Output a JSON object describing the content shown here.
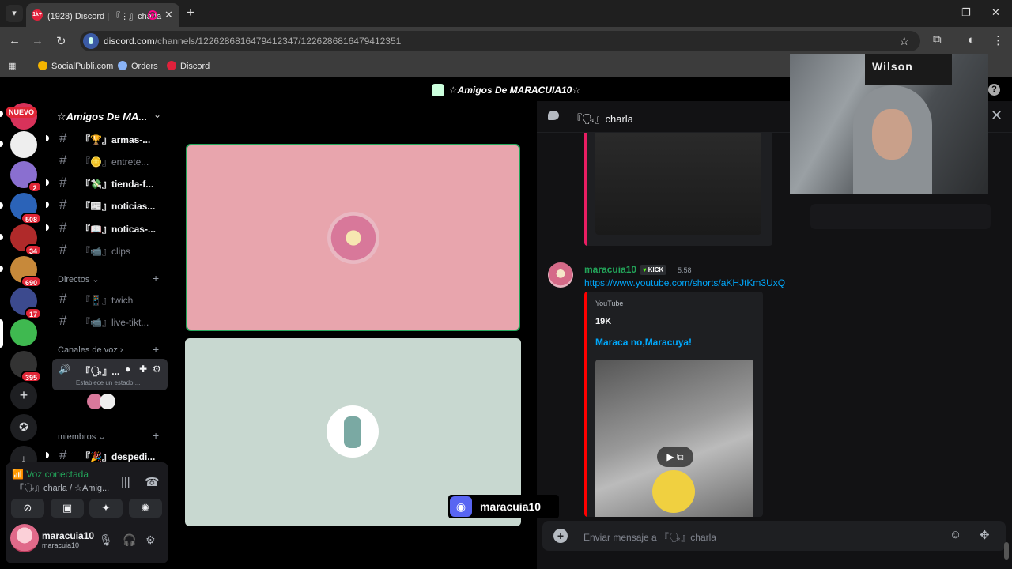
{
  "browser": {
    "tab_title": "(1928) Discord | 『⋮』charla",
    "tab_favicon_text": "1k+",
    "url_host": "discord.com",
    "url_path": "/channels/1226286816479412347/1226286816479412351",
    "bookmarks": [
      {
        "label": "SocialPubli.com",
        "color": "#f4b400"
      },
      {
        "label": "Orders",
        "color": "#8ab4f8"
      },
      {
        "label": "Discord",
        "color": "#e0213b"
      }
    ]
  },
  "discord": {
    "top_title": "☆Amigos De MARACUIA10☆",
    "servers": {
      "nuevo": "NUEVO",
      "badges": [
        "2",
        "508",
        "34",
        "690",
        "17",
        "395"
      ]
    },
    "guild_name": "☆Amigos De MA...",
    "channels": [
      {
        "label": "『🏆』armas-...",
        "unread": true
      },
      {
        "label": "『🪙』entrete...",
        "unread": false
      },
      {
        "label": "『💸』tienda-f...",
        "unread": true
      },
      {
        "label": "『📰』noticias...",
        "unread": true
      },
      {
        "label": "『📖』noticas-...",
        "unread": true
      },
      {
        "label": "『📹』clips",
        "unread": false
      }
    ],
    "category_directos": "Directos",
    "directos_channels": [
      {
        "label": "『📱』twich"
      },
      {
        "label": "『📹』live-tikt..."
      }
    ],
    "category_voz": "Canales de voz",
    "voice_channel": {
      "label": "『🗣』...",
      "status": "Establece un estado ..."
    },
    "category_miembros": "miembros",
    "miembros_channels": [
      {
        "label": "『🎉』despedi..."
      }
    ],
    "voice_panel": {
      "status": "Voz conectada",
      "sub": "『🗣』charla / ☆Amig...",
      "username": "maracuia10",
      "user_tag": "maracuia10"
    },
    "stage": {
      "overlay_name": "maracuia10"
    },
    "chat": {
      "channel_name": "『🗣』charla",
      "message": {
        "username": "maracuia10",
        "tag": "KICK",
        "time": "5:58",
        "link": "https://www.youtube.com/shorts/aKHJtKm3UxQ",
        "embed_provider": "YouTube",
        "embed_author": "19K",
        "embed_title": "Maraca no,Maracuya!"
      },
      "input_placeholder": "Enviar mensaje a 『🗣』charla"
    },
    "webcam_brand": "Wilson"
  }
}
